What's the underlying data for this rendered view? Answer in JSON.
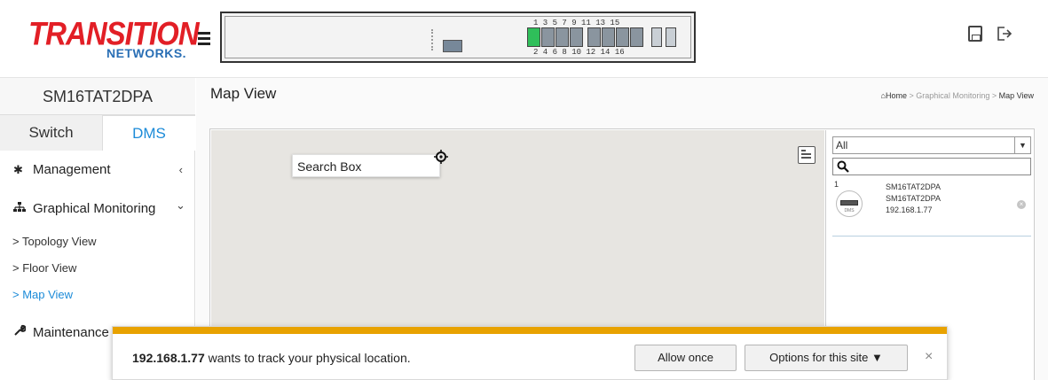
{
  "brand": {
    "logo_main": "TRANSITION",
    "logo_sub": "NETWORKS."
  },
  "device_panel": {
    "top_port_labels": "1  3  5  7  9 11 13 15",
    "bottom_port_labels": "2  4  6  8 10 12 14 16",
    "link_up_port": "1"
  },
  "header_icons": {
    "save": "save-icon",
    "logout": "logout-icon"
  },
  "sidebar": {
    "device_name": "SM16TAT2DPA",
    "tabs": [
      {
        "label": "Switch"
      },
      {
        "label": "DMS"
      }
    ],
    "menu": [
      {
        "label": "Management",
        "icon": "gear-icon",
        "chevron": "‹"
      },
      {
        "label": "Graphical Monitoring",
        "icon": "sitemap-icon",
        "chevron": "⌄"
      },
      {
        "label": "Maintenance",
        "icon": "wrench-icon"
      }
    ],
    "sub_items": [
      {
        "label": "> Topology View"
      },
      {
        "label": "> Floor View"
      },
      {
        "label": "> Map View"
      }
    ]
  },
  "main": {
    "title": "Map View",
    "breadcrumb": {
      "home": "Home",
      "sep": ">",
      "section": "Graphical Monitoring",
      "current": "Map View"
    }
  },
  "map": {
    "search_box": "Search Box"
  },
  "device_list": {
    "filter_value": "All",
    "entries": [
      {
        "index": "1",
        "name": "SM16TAT2DPA",
        "model": "SM16TAT2DPA",
        "ip": "192.168.1.77",
        "icon_label": "DMS"
      }
    ]
  },
  "location_prompt": {
    "host": "192.168.1.77",
    "message": " wants to track your physical location.",
    "allow_label": "Allow once",
    "options_label": "Options for this site ▼",
    "close_label": "×",
    "accent_color": "#e8a200"
  }
}
